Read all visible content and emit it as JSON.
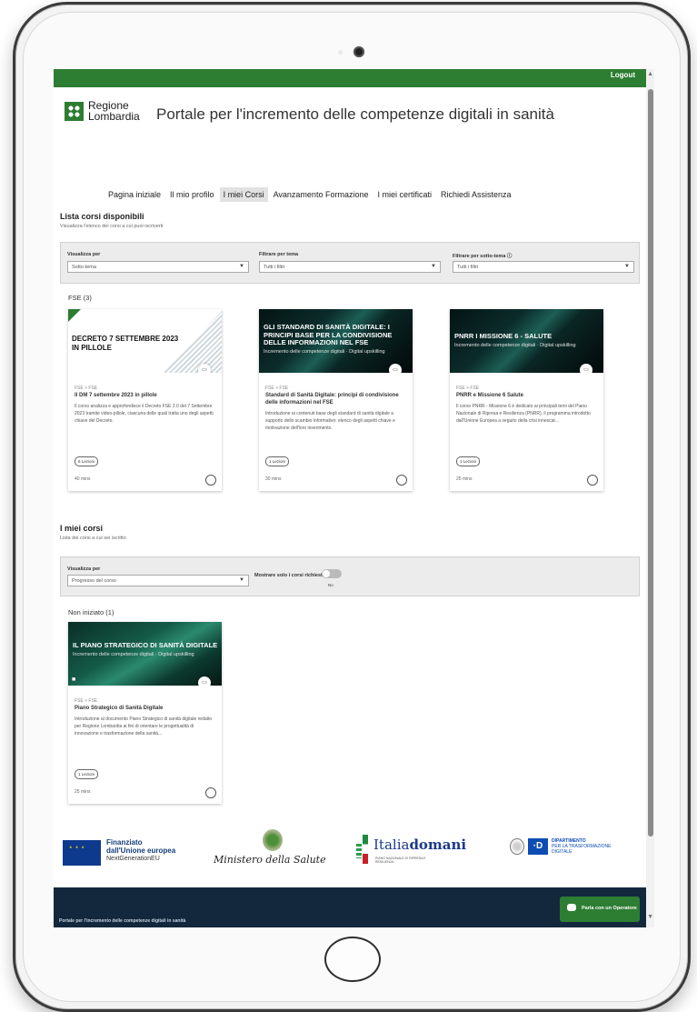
{
  "header": {
    "logout_label": "Logout",
    "brand_line1": "Regione",
    "brand_line2": "Lombardia",
    "portal_title": "Portale per l'incremento delle competenze digitali in sanità"
  },
  "nav": {
    "items": [
      {
        "label": "Pagina iniziale"
      },
      {
        "label": "Il mio profilo"
      },
      {
        "label": "I miei Corsi"
      },
      {
        "label": "Avanzamento Formazione"
      },
      {
        "label": "I miei certificati"
      },
      {
        "label": "Richiedi Assistenza"
      }
    ],
    "active": "I miei Corsi"
  },
  "available": {
    "title": "Lista corsi disponibili",
    "subtitle": "Visualizza l'elenco dei corsi a cui puoi iscriverti",
    "filters": {
      "view_label": "Visualizza per",
      "view_value": "Sotto-tema",
      "theme_label": "Filtrare per tema",
      "theme_value": "Tutti i filtri",
      "subtheme_label": "Filtrare per sotto-tema",
      "subtheme_value": "Tutti i filtri"
    },
    "group_title": "FSE (3)",
    "cards": [
      {
        "image_title": "DECRETO 7 SETTEMBRE 2023 IN PILLOLE",
        "image_subtitle": "",
        "breadcrumb": "FSE > FSE",
        "title": "Il DM 7 settembre 2023 in pillole",
        "description": "Il corso analizza e approfondisce il Decreto FSE 2.0 del 7 Settembre 2023 tramite video-pillole, ciascuna delle quali tratta uno degli aspetti chiave del Decreto.",
        "lessons": "6 Lezioni",
        "duration": "40 mins"
      },
      {
        "image_title": "GLI STANDARD DI SANITÀ DIGITALE: I PRINCIPI BASE PER LA CONDIVISIONE DELLE INFORMAZIONI NEL FSE",
        "image_subtitle": "Incremento delle competenze digitali · Digital upskilling",
        "breadcrumb": "FSE > FSE",
        "title": "Standard di Sanità Digitale: principi di condivisione delle informazioni nel FSE",
        "description": "Introduzione ai contenuti base degli standard di sanità digitale a supporto dello scambio informativo: elenco degli aspetti chiave e motivazione dell'loro inserimento.",
        "lessons": "1 Lezioni",
        "duration": "30 mins"
      },
      {
        "image_title": "PNRR I MISSIONE 6 - SALUTE",
        "image_subtitle": "Incremento delle competenze digitali · Digital upskilling",
        "breadcrumb": "FSE > FSE",
        "title": "PNRR e Missione 6 Salute",
        "description": "Il corso PNRR - Missione 6 è dedicato ai principali temi del Piano Nazionale di Ripresa e Resilienza (PNRR), il programma introdotto dall'Unione Europea a seguito della crisi innescat...",
        "lessons": "1 Lezioni",
        "duration": "25 mins"
      }
    ]
  },
  "my_courses": {
    "title": "I miei corsi",
    "subtitle": "Lista dei corsi a cui sei iscritto",
    "view_label": "Visualizza per",
    "view_value": "Progresso del corso",
    "toggle_label": "Mostrare solo i corsi richiesti",
    "toggle_state": "No",
    "group_title": "Non iniziato (1)",
    "card": {
      "image_title": "IL PIANO STRATEGICO DI SANITÀ DIGITALE",
      "image_subtitle": "Incremento delle competenze digitali · Digital upskilling",
      "breadcrumb": "FSE > FSE",
      "title": "Piano Strategico di Sanità Digitale",
      "description": "Introduzione al documento Piano Strategico di sanità digitale redatto per Regione Lombardia ai fini di orientare le progettualità di innovazione e trasformazione della sanità...",
      "lessons": "1 Lezioni",
      "duration": "25 mins"
    }
  },
  "footer": {
    "eu_line1": "Finanziato",
    "eu_line2": "dall'Unione europea",
    "eu_line3": "NextGenerationEU",
    "ministry": "Ministero della Salute",
    "italia_a": "Italia",
    "italia_b": "domani",
    "italia_sub": "PIANO NAZIONALE DI RIPRESA E RESILIENZA",
    "dtd_line1": "DIPARTIMENTO",
    "dtd_line2": "PER LA TRASFORMAZIONE",
    "dtd_line3": "DIGITALE",
    "note": "Portale per l'incremento delle competenze digitali in sanità",
    "chat_label": "Parla con un Operatore"
  },
  "colors": {
    "brand_green": "#2d7d32",
    "footer_navy": "#13283d"
  }
}
